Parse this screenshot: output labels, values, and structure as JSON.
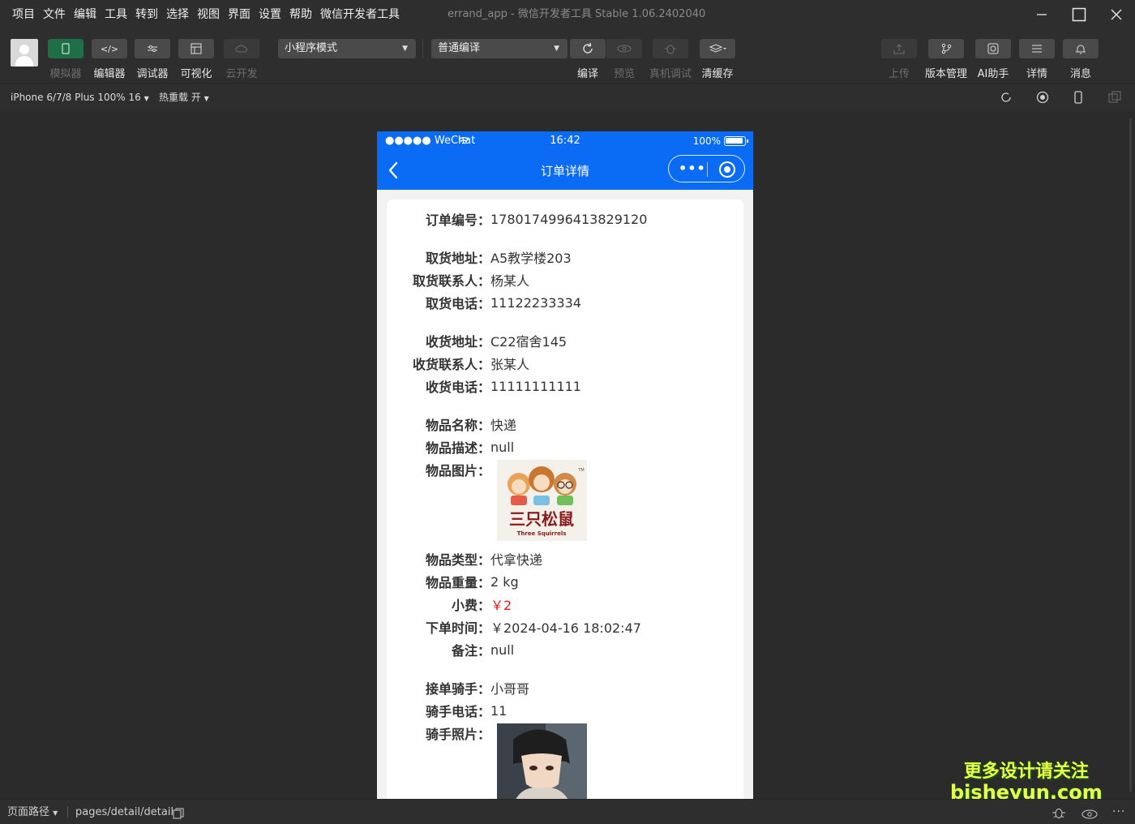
{
  "menubar": {
    "items": [
      "项目",
      "文件",
      "编辑",
      "工具",
      "转到",
      "选择",
      "视图",
      "界面",
      "设置",
      "帮助",
      "微信开发者工具"
    ],
    "window_title": "errand_app - 微信开发者工具 Stable 1.06.2402040"
  },
  "toolbar": {
    "left_buttons": [
      {
        "label": "模拟器",
        "icon": "phone-icon",
        "enabled": true
      },
      {
        "label": "编辑器",
        "icon": "code-icon",
        "enabled": true
      },
      {
        "label": "调试器",
        "icon": "sliders-icon",
        "enabled": true
      },
      {
        "label": "可视化",
        "icon": "layout-icon",
        "enabled": true
      },
      {
        "label": "云开发",
        "icon": "cloud-icon",
        "enabled": false
      }
    ],
    "mode_select": "小程序模式",
    "compile_select": "普通编译",
    "mid_buttons": [
      {
        "label": "编译",
        "icon": "refresh-icon"
      },
      {
        "label": "预览",
        "icon": "eye-icon"
      },
      {
        "label": "真机调试",
        "icon": "bug-icon"
      },
      {
        "label": "清缓存",
        "icon": "layers-icon"
      }
    ],
    "right_buttons": [
      {
        "label": "上传",
        "icon": "upload-icon"
      },
      {
        "label": "版本管理",
        "icon": "branch-icon"
      },
      {
        "label": "AI助手",
        "icon": "ai-icon"
      },
      {
        "label": "详情",
        "icon": "menu-icon"
      },
      {
        "label": "消息",
        "icon": "bell-icon"
      }
    ]
  },
  "devbar": {
    "device": "iPhone 6/7/8 Plus 100% 16",
    "hot_reload": "热重载 开"
  },
  "phone": {
    "status": {
      "carrier": "●●●●● WeChat",
      "time": "16:42",
      "battery": "100%"
    },
    "nav_title": "订单详情",
    "capsule_dots": "•••",
    "rows": [
      {
        "label": "订单编号：",
        "value": "1780174996413829120"
      },
      {
        "label": "取货地址：",
        "value": "A5教学楼203"
      },
      {
        "label": "取货联系人：",
        "value": "杨某人"
      },
      {
        "label": "取货电话：",
        "value": "11122233334"
      },
      {
        "label": "收货地址：",
        "value": "C22宿舍145"
      },
      {
        "label": "收货联系人：",
        "value": "张某人"
      },
      {
        "label": "收货电话：",
        "value": "11111111111"
      },
      {
        "label": "物品名称：",
        "value": "快递"
      },
      {
        "label": "物品描述：",
        "value": "null"
      },
      {
        "label": "物品图片：",
        "value": ""
      },
      {
        "label": "物品类型：",
        "value": "代拿快递"
      },
      {
        "label": "物品重量：",
        "value": "2 kg"
      },
      {
        "label": "小费：",
        "value": "￥2"
      },
      {
        "label": "下单时间：",
        "value": "￥2024-04-16 18:02:47"
      },
      {
        "label": "备注：",
        "value": "null"
      },
      {
        "label": "接单骑手：",
        "value": "小哥哥"
      },
      {
        "label": "骑手电话：",
        "value": "11"
      },
      {
        "label": "骑手照片：",
        "value": ""
      }
    ],
    "item_image_text": {
      "brand": "三只松鼠",
      "brand_en": "Three Squirrels",
      "tm": "TM"
    },
    "tip_color": "#e02020",
    "nav_color": "#0a6cf5"
  },
  "bottombar": {
    "path_label": "页面路径",
    "path": "pages/detail/detail"
  },
  "watermark": {
    "line1": "更多设计请关注",
    "line2": "bisheyun.com"
  }
}
